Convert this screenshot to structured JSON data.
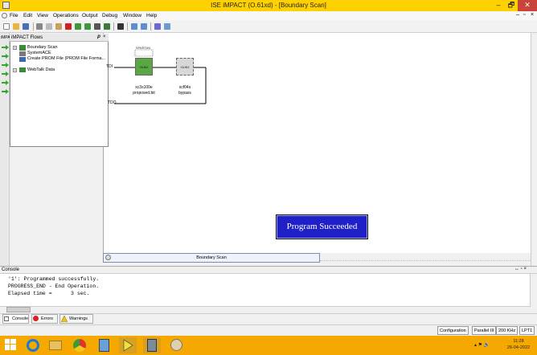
{
  "window": {
    "title": "ISE iMPACT (O.61xd) - [Boundary Scan]",
    "min_glyph": "–",
    "max_glyph": "🗗",
    "close_glyph": "✕"
  },
  "menu": [
    "File",
    "Edit",
    "View",
    "Operations",
    "Output",
    "Debug",
    "Window",
    "Help"
  ],
  "flows_panel": {
    "title": "iMPACT Flows",
    "items": [
      "Boundary Scan",
      "SystemACE",
      "Create PROM File (PROM File Forma...",
      "WebTalk Data"
    ],
    "side_tab": "iMPA"
  },
  "chain": {
    "tdi_label": "TDI",
    "tdo_label": "TDO",
    "device1_top": "SPARTAN",
    "device1_part": "xc3s100e",
    "device1_file": "proposed.bit",
    "device2_part": "xcf04s",
    "device2_file": "bypass",
    "chip_logo": "XILINX"
  },
  "status_popup": "Program Succeeded",
  "workspace_tab": "Boundary Scan",
  "console": {
    "title": "Console",
    "lines": [
      "'1': Programmed successfully.",
      "PROGRESS_END - End Operation.",
      "Elapsed time =      3 sec."
    ],
    "tabs": [
      "Console",
      "Errors",
      "Warnings"
    ]
  },
  "statusbar": [
    "Configuration",
    "Parallel III",
    "200 KHz",
    "LPT1"
  ],
  "taskbar": {
    "time": "11:28",
    "date": "26-04-2022"
  },
  "colors": {
    "titlebar": "#ffd100",
    "taskbar": "#f5a800",
    "popup": "#2020c8",
    "device_active": "#5aa844"
  }
}
